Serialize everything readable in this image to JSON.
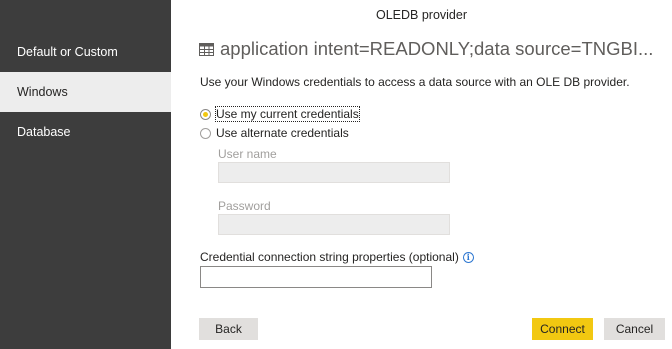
{
  "sidebar": {
    "items": [
      {
        "label": "Default or Custom",
        "active": false
      },
      {
        "label": "Windows",
        "active": true
      },
      {
        "label": "Database",
        "active": false
      }
    ]
  },
  "dialog": {
    "title": "OLEDB provider",
    "heading": "application intent=READONLY;data source=TNGBI...",
    "description": "Use your Windows credentials to access a data source with an OLE DB provider."
  },
  "options": {
    "current_label": "Use my current credentials",
    "alternate_label": "Use alternate credentials",
    "selected": "current"
  },
  "fields": {
    "username_label": "User name",
    "username_value": "",
    "password_label": "Password",
    "password_value": "",
    "connstring_label": "Credential connection string properties (optional)",
    "connstring_value": ""
  },
  "buttons": {
    "back": "Back",
    "connect": "Connect",
    "cancel": "Cancel"
  },
  "colors": {
    "sidebar_bg": "#3d3d3d",
    "sidebar_active_bg": "#ededed",
    "accent": "#f2c811",
    "info": "#2f78d1"
  },
  "icons": {
    "heading": "table-icon",
    "info": "info-icon"
  }
}
